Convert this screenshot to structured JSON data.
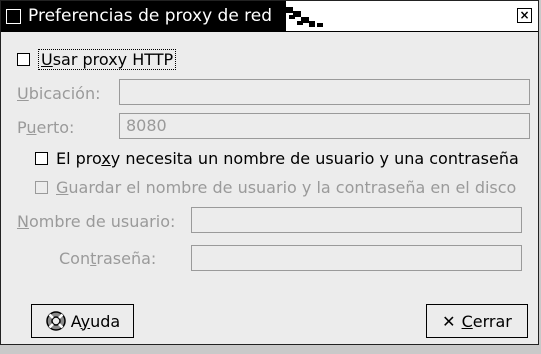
{
  "window": {
    "title": "Preferencias de proxy de red",
    "close_glyph": "×"
  },
  "use_http_proxy": {
    "label_parts": [
      "",
      "U",
      "sar proxy HTTP"
    ],
    "checked": false
  },
  "location": {
    "label_parts": [
      "",
      "U",
      "bicación:"
    ],
    "value": ""
  },
  "port": {
    "label_parts": [
      "P",
      "u",
      "erto:"
    ],
    "value": "8080"
  },
  "auth_required": {
    "label_parts": [
      "El pro",
      "x",
      "y necesita un nombre de usuario y una contraseña"
    ],
    "checked": false
  },
  "save_credentials": {
    "label_parts": [
      "",
      "G",
      "uardar el nombre de usuario y la contraseña en el disco"
    ],
    "checked": false
  },
  "username": {
    "label_parts": [
      "",
      "N",
      "ombre de usuario:"
    ],
    "value": ""
  },
  "password": {
    "label_parts": [
      "Con",
      "t",
      "raseña:"
    ],
    "value": ""
  },
  "buttons": {
    "help_parts": [
      "A",
      "y",
      "uda"
    ],
    "close_parts": [
      "",
      "C",
      "errar"
    ],
    "close_icon": "✕"
  },
  "colors": {
    "title_bg": "#000000",
    "window_bg": "#ececec",
    "disabled_text": "#9a9a9a"
  }
}
